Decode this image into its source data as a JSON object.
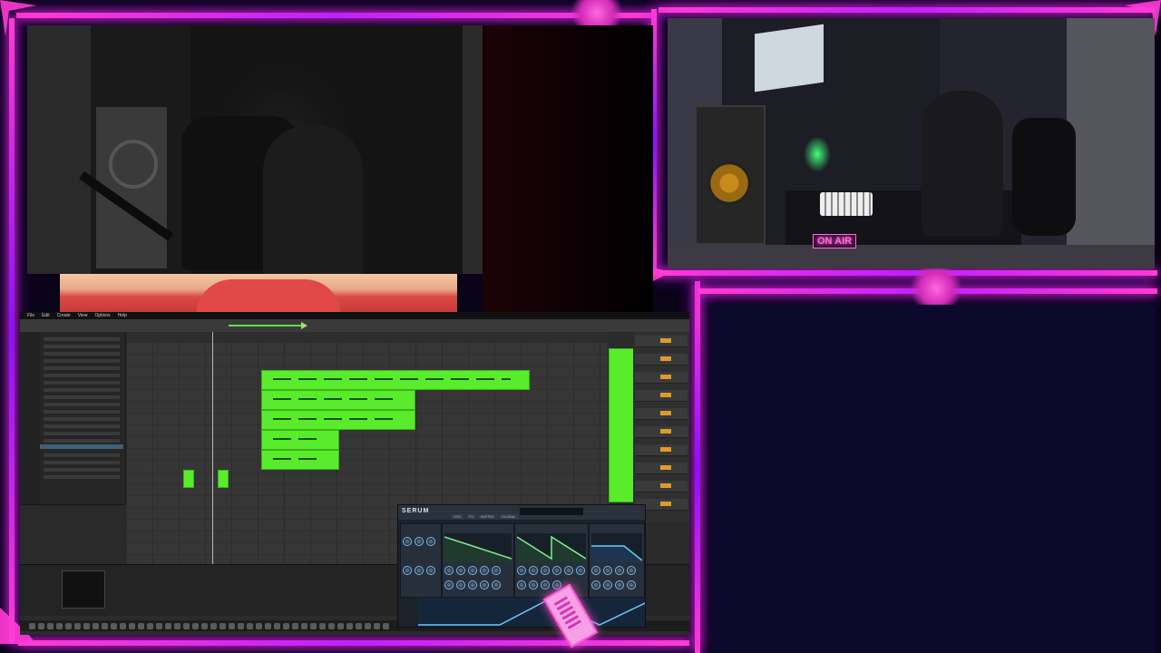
{
  "overlay": {
    "on_air_sign": "ON AIR"
  },
  "daw": {
    "menu": [
      "File",
      "Edit",
      "Create",
      "View",
      "Options",
      "Help"
    ],
    "window_title": "",
    "clock": ""
  },
  "serum": {
    "logo": "SERUM",
    "tabs": [
      "OSC",
      "FX",
      "MATRIX",
      "GLOBAL"
    ],
    "preset_name": ""
  },
  "colors": {
    "neon_frame": "#ff3bd4",
    "clip_green": "#59ec2c",
    "empty_pane": "#0b0a2c"
  }
}
